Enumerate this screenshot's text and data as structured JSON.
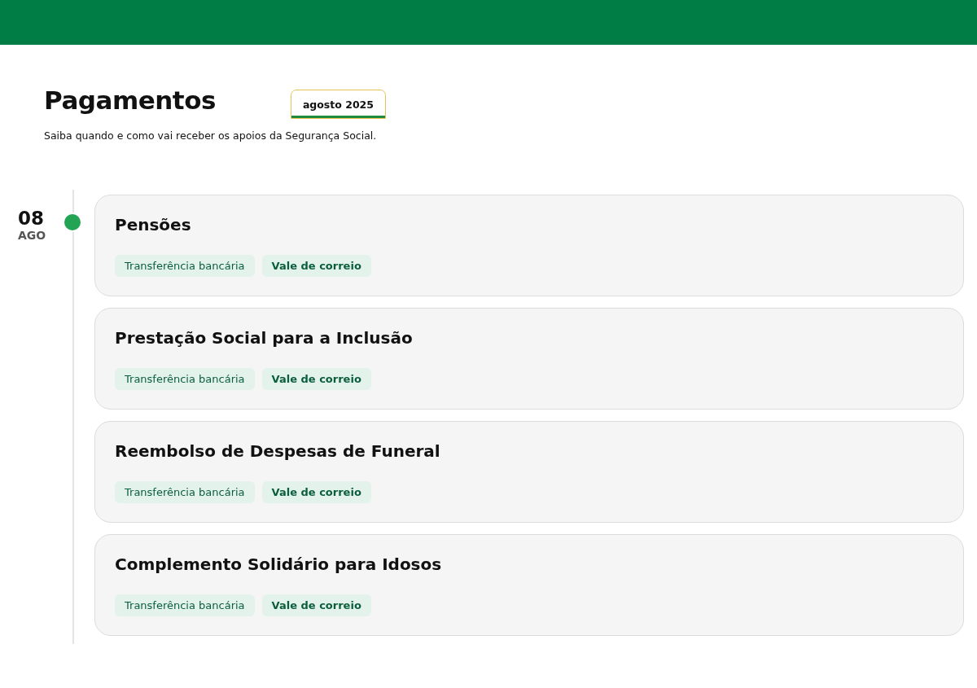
{
  "page": {
    "title": "Pagamentos",
    "subtitle": "Saiba quando e como vai receber os apoios da Segurança Social."
  },
  "tabs": [
    {
      "label": "agosto 2025",
      "selected": true
    }
  ],
  "timeline": [
    {
      "day": "08",
      "month": "AGO",
      "active": true,
      "payments": [
        {
          "title": "Pensões",
          "methods": [
            "Transferência bancária",
            "Vale de correio"
          ]
        },
        {
          "title": "Prestação Social para a Inclusão",
          "methods": [
            "Transferência bancária",
            "Vale de correio"
          ]
        },
        {
          "title": "Reembolso de Despesas de Funeral",
          "methods": [
            "Transferência bancária",
            "Vale de correio"
          ]
        },
        {
          "title": "Complemento Solidário para Idosos",
          "methods": [
            "Transferência bancária",
            "Vale de correio"
          ]
        }
      ]
    }
  ]
}
